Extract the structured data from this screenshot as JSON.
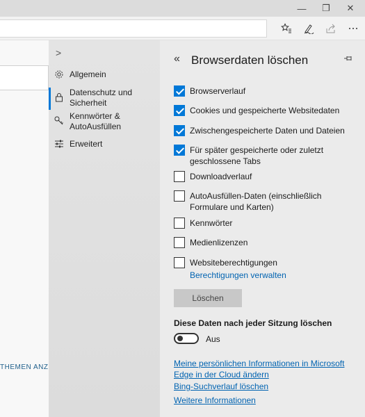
{
  "window": {
    "minimize_glyph": "—",
    "maximize_glyph": "❐",
    "close_glyph": "✕"
  },
  "toolbar": {
    "icons": [
      "favorites-star-icon",
      "pen-icon",
      "share-icon",
      "more-icon"
    ]
  },
  "page": {
    "partial_text": "THEMEN ANZ"
  },
  "nav": {
    "toggle_glyph": ">",
    "items": [
      {
        "label": "Allgemein",
        "icon": "gear-icon"
      },
      {
        "label": "Datenschutz und Sicherheit",
        "icon": "lock-icon",
        "active": true
      },
      {
        "label": "Kennwörter & AutoAusfüllen",
        "icon": "key-icon"
      },
      {
        "label": "Erweitert",
        "icon": "sliders-icon"
      }
    ]
  },
  "panel": {
    "back_glyph": "«",
    "title": "Browserdaten löschen",
    "options": [
      {
        "label": "Browserverlauf",
        "checked": true
      },
      {
        "label": "Cookies und gespeicherte Websitedaten",
        "checked": true
      },
      {
        "label": "Zwischengespeicherte Daten und Dateien",
        "checked": true
      },
      {
        "label": "Für später gespeicherte oder zuletzt geschlossene Tabs",
        "checked": true
      },
      {
        "label": "Downloadverlauf",
        "checked": false
      },
      {
        "label": "AutoAusfüllen-Daten (einschließlich Formulare und Karten)",
        "checked": false
      },
      {
        "label": "Kennwörter",
        "checked": false
      },
      {
        "label": "Medienlizenzen",
        "checked": false
      },
      {
        "label": "Websiteberechtigungen",
        "checked": false
      }
    ],
    "manage_permissions_link": "Berechtigungen verwalten",
    "delete_button": "Löschen",
    "clear_on_close_title": "Diese Daten nach jeder Sitzung löschen",
    "toggle_state": "Aus",
    "links": [
      "Meine persönlichen Informationen in Microsoft Edge in der Cloud ändern",
      "Bing-Suchverlauf löschen",
      "Weitere Informationen"
    ]
  },
  "colors": {
    "accent": "#0078d7",
    "link": "#0063b1"
  }
}
